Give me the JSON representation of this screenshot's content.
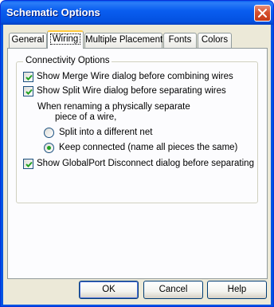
{
  "window": {
    "title": "Schematic Options"
  },
  "tabs": [
    {
      "label": "General"
    },
    {
      "label": "Wiring"
    },
    {
      "label": "Multiple Placement"
    },
    {
      "label": "Fonts"
    },
    {
      "label": "Colors"
    }
  ],
  "active_tab": "Wiring",
  "group": {
    "title": "Connectivity Options",
    "merge_wire": {
      "label": "Show Merge Wire dialog before combining wires",
      "checked": true
    },
    "split_wire": {
      "label": "Show Split Wire dialog before separating wires",
      "checked": true
    },
    "rename_text_line1": "When renaming a physically separate",
    "rename_text_line2": "piece of a wire,",
    "split_net": {
      "label": "Split into a different net",
      "selected": false
    },
    "keep_connected": {
      "label": "Keep connected (name all pieces the same)",
      "selected": true
    },
    "globalport": {
      "label": "Show GlobalPort Disconnect dialog before separating",
      "checked": true
    }
  },
  "buttons": {
    "ok": "OK",
    "cancel": "Cancel",
    "help": "Help"
  }
}
